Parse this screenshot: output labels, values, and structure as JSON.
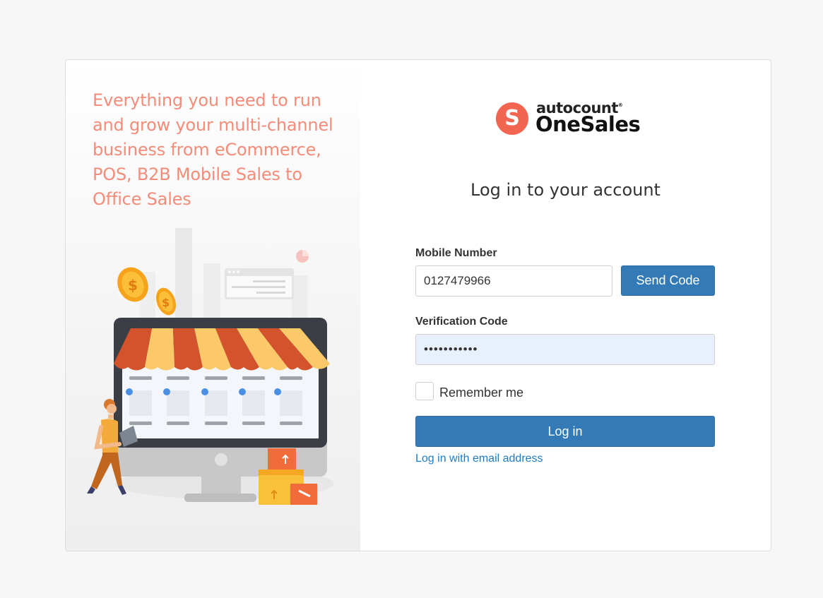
{
  "left": {
    "tagline": "Everything you need to run and grow your multi-channel business from eCommerce, POS, B2B Mobile Sales to Office Sales"
  },
  "brand": {
    "logo_letter": "S",
    "top_text": "autocount",
    "registered": "®",
    "bottom_text": "OneSales",
    "accent": "#f26551"
  },
  "form": {
    "title": "Log in to your account",
    "mobile_label": "Mobile Number",
    "mobile_value": "0127479966",
    "send_code_label": "Send Code",
    "code_label": "Verification Code",
    "code_value": "•••••••••••",
    "remember_label": "Remember me",
    "login_label": "Log in",
    "email_link": "Log in with email address"
  },
  "colors": {
    "primary": "#337ab7",
    "tagline": "#f58c79",
    "link": "#1a7cc8",
    "autofill": "#e8f0fe"
  }
}
